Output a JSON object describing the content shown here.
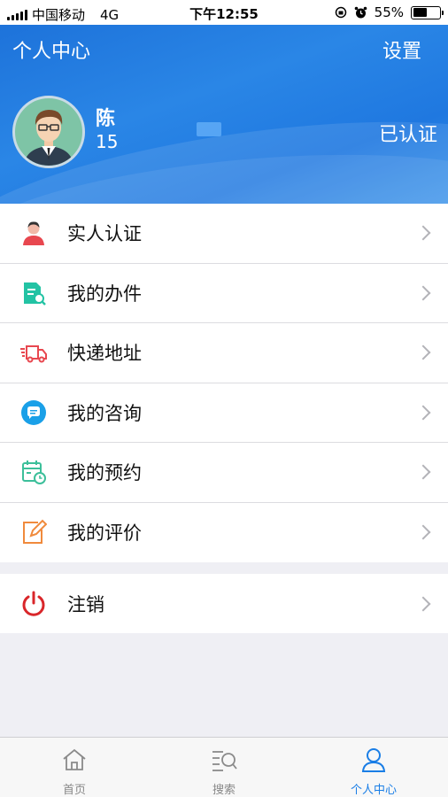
{
  "status_bar": {
    "carrier": "中国移动",
    "network": "4G",
    "time": "下午12:55",
    "battery": "55%",
    "battery_level": 0.55
  },
  "header": {
    "title": "个人中心",
    "settings_label": "设置"
  },
  "profile": {
    "name": "陈",
    "phone": "15",
    "status": "已认证"
  },
  "menu": {
    "items": [
      {
        "label": "实人认证",
        "icon": "person-icon"
      },
      {
        "label": "我的办件",
        "icon": "document-search-icon"
      },
      {
        "label": "快递地址",
        "icon": "delivery-truck-icon"
      },
      {
        "label": "我的咨询",
        "icon": "chat-bubble-icon"
      },
      {
        "label": "我的预约",
        "icon": "calendar-clock-icon"
      },
      {
        "label": "我的评价",
        "icon": "edit-icon"
      }
    ],
    "logout_label": "注销"
  },
  "tabbar": {
    "tabs": [
      {
        "label": "首页",
        "icon": "home-icon"
      },
      {
        "label": "搜索",
        "icon": "search-list-icon"
      },
      {
        "label": "个人中心",
        "icon": "user-icon"
      }
    ],
    "active_index": 2
  },
  "colors": {
    "brand_blue": "#1f78e0",
    "tab_active": "#1a7ee6",
    "logout_red": "#d9262a"
  }
}
